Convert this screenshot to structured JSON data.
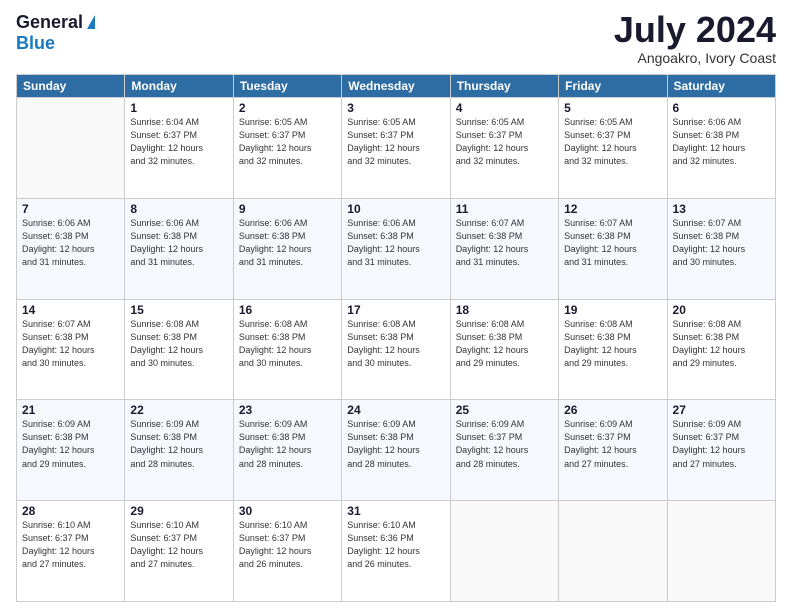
{
  "logo": {
    "general": "General",
    "blue": "Blue"
  },
  "header": {
    "month_year": "July 2024",
    "location": "Angoakro, Ivory Coast"
  },
  "days_of_week": [
    "Sunday",
    "Monday",
    "Tuesday",
    "Wednesday",
    "Thursday",
    "Friday",
    "Saturday"
  ],
  "weeks": [
    [
      {
        "day": "",
        "info": ""
      },
      {
        "day": "1",
        "info": "Sunrise: 6:04 AM\nSunset: 6:37 PM\nDaylight: 12 hours\nand 32 minutes."
      },
      {
        "day": "2",
        "info": "Sunrise: 6:05 AM\nSunset: 6:37 PM\nDaylight: 12 hours\nand 32 minutes."
      },
      {
        "day": "3",
        "info": "Sunrise: 6:05 AM\nSunset: 6:37 PM\nDaylight: 12 hours\nand 32 minutes."
      },
      {
        "day": "4",
        "info": "Sunrise: 6:05 AM\nSunset: 6:37 PM\nDaylight: 12 hours\nand 32 minutes."
      },
      {
        "day": "5",
        "info": "Sunrise: 6:05 AM\nSunset: 6:37 PM\nDaylight: 12 hours\nand 32 minutes."
      },
      {
        "day": "6",
        "info": "Sunrise: 6:06 AM\nSunset: 6:38 PM\nDaylight: 12 hours\nand 32 minutes."
      }
    ],
    [
      {
        "day": "7",
        "info": "Sunrise: 6:06 AM\nSunset: 6:38 PM\nDaylight: 12 hours\nand 31 minutes."
      },
      {
        "day": "8",
        "info": "Sunrise: 6:06 AM\nSunset: 6:38 PM\nDaylight: 12 hours\nand 31 minutes."
      },
      {
        "day": "9",
        "info": "Sunrise: 6:06 AM\nSunset: 6:38 PM\nDaylight: 12 hours\nand 31 minutes."
      },
      {
        "day": "10",
        "info": "Sunrise: 6:06 AM\nSunset: 6:38 PM\nDaylight: 12 hours\nand 31 minutes."
      },
      {
        "day": "11",
        "info": "Sunrise: 6:07 AM\nSunset: 6:38 PM\nDaylight: 12 hours\nand 31 minutes."
      },
      {
        "day": "12",
        "info": "Sunrise: 6:07 AM\nSunset: 6:38 PM\nDaylight: 12 hours\nand 31 minutes."
      },
      {
        "day": "13",
        "info": "Sunrise: 6:07 AM\nSunset: 6:38 PM\nDaylight: 12 hours\nand 30 minutes."
      }
    ],
    [
      {
        "day": "14",
        "info": "Sunrise: 6:07 AM\nSunset: 6:38 PM\nDaylight: 12 hours\nand 30 minutes."
      },
      {
        "day": "15",
        "info": "Sunrise: 6:08 AM\nSunset: 6:38 PM\nDaylight: 12 hours\nand 30 minutes."
      },
      {
        "day": "16",
        "info": "Sunrise: 6:08 AM\nSunset: 6:38 PM\nDaylight: 12 hours\nand 30 minutes."
      },
      {
        "day": "17",
        "info": "Sunrise: 6:08 AM\nSunset: 6:38 PM\nDaylight: 12 hours\nand 30 minutes."
      },
      {
        "day": "18",
        "info": "Sunrise: 6:08 AM\nSunset: 6:38 PM\nDaylight: 12 hours\nand 29 minutes."
      },
      {
        "day": "19",
        "info": "Sunrise: 6:08 AM\nSunset: 6:38 PM\nDaylight: 12 hours\nand 29 minutes."
      },
      {
        "day": "20",
        "info": "Sunrise: 6:08 AM\nSunset: 6:38 PM\nDaylight: 12 hours\nand 29 minutes."
      }
    ],
    [
      {
        "day": "21",
        "info": "Sunrise: 6:09 AM\nSunset: 6:38 PM\nDaylight: 12 hours\nand 29 minutes."
      },
      {
        "day": "22",
        "info": "Sunrise: 6:09 AM\nSunset: 6:38 PM\nDaylight: 12 hours\nand 28 minutes."
      },
      {
        "day": "23",
        "info": "Sunrise: 6:09 AM\nSunset: 6:38 PM\nDaylight: 12 hours\nand 28 minutes."
      },
      {
        "day": "24",
        "info": "Sunrise: 6:09 AM\nSunset: 6:38 PM\nDaylight: 12 hours\nand 28 minutes."
      },
      {
        "day": "25",
        "info": "Sunrise: 6:09 AM\nSunset: 6:37 PM\nDaylight: 12 hours\nand 28 minutes."
      },
      {
        "day": "26",
        "info": "Sunrise: 6:09 AM\nSunset: 6:37 PM\nDaylight: 12 hours\nand 27 minutes."
      },
      {
        "day": "27",
        "info": "Sunrise: 6:09 AM\nSunset: 6:37 PM\nDaylight: 12 hours\nand 27 minutes."
      }
    ],
    [
      {
        "day": "28",
        "info": "Sunrise: 6:10 AM\nSunset: 6:37 PM\nDaylight: 12 hours\nand 27 minutes."
      },
      {
        "day": "29",
        "info": "Sunrise: 6:10 AM\nSunset: 6:37 PM\nDaylight: 12 hours\nand 27 minutes."
      },
      {
        "day": "30",
        "info": "Sunrise: 6:10 AM\nSunset: 6:37 PM\nDaylight: 12 hours\nand 26 minutes."
      },
      {
        "day": "31",
        "info": "Sunrise: 6:10 AM\nSunset: 6:36 PM\nDaylight: 12 hours\nand 26 minutes."
      },
      {
        "day": "",
        "info": ""
      },
      {
        "day": "",
        "info": ""
      },
      {
        "day": "",
        "info": ""
      }
    ]
  ]
}
